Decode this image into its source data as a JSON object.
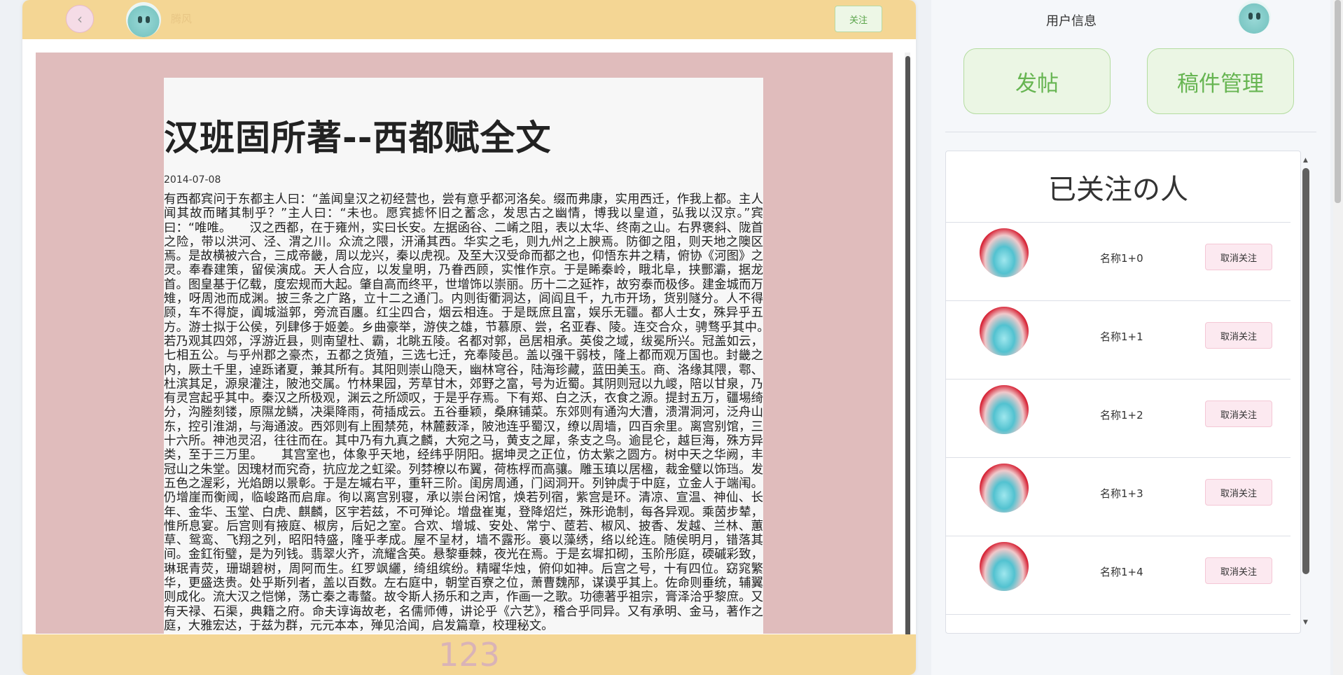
{
  "header": {
    "back_icon": "‹",
    "author_name": "腾风",
    "follow_label": "关注"
  },
  "article": {
    "title": "汉班固所著--西都赋全文",
    "date": "2014-07-08",
    "body": "有西都宾问于东都主人曰：“盖闻皇汉之初经营也，尝有意乎都河洛矣。缀而弗康，实用西迁，作我上都。主人闻其故而睹其制乎？”主人曰：“未也。愿宾摅怀旧之蓄念，发思古之幽情，博我以皇道，弘我以汉京。”宾曰：“唯唯。　　汉之西都，在于雍州，实曰长安。左据函谷、二崤之阻，表以太华、终南之山。右界褒斜、陇首之险，带以洪河、泾、渭之川。众流之隈，汧涌其西。华实之毛，则九州之上腴焉。防御之阻，则天地之隩区焉。是故横被六合，三成帝畿，周以龙兴，秦以虎视。及至大汉受命而都之也，仰悟东井之精，俯协《河图》之灵。奉春建策，留侯演成。天人合应，以发皇明，乃眷西顾，实惟作京。于是睎秦岭，睋北阜，挟酆灞，据龙首。图皇基于亿载，度宏规而大起。肇自高而终平，世增饰以崇丽。历十二之延祚，故穷泰而极侈。建金城而万雉，呀周池而成渊。披三条之广路，立十二之通门。内则街衢洞达，闾阎且千，九市开场，货别隧分。人不得顾，车不得旋，阗城溢郭，旁流百廛。红尘四合，烟云相连。于是既庶且富，娱乐无疆。都人士女，殊异乎五方。游士拟于公侯，列肆侈于姬姜。乡曲豪举，游侠之雄，节慕原、尝，名亚春、陵。连交合众，骋骛乎其中。　　若乃观其四郊，浮游近县，则南望杜、霸，北眺五陵。名都对郭，邑居相承。英俊之域，绂冕所兴。冠盖如云，七相五公。与乎州郡之豪杰，五都之货殖，三选七迁，充奉陵邑。盖以强干弱枝，隆上都而观万国也。封畿之内，厥土千里，逴跞诸夏，兼其所有。其阳则崇山隐天，幽林穹谷，陆海珍藏，蓝田美玉。商、洛缘其隈，鄠、杜滨其足，源泉灌注，陂池交属。竹林果园，芳草甘木，郊野之富，号为近蜀。其阴则冠以九嵕，陪以甘泉，乃有灵宫起乎其中。秦汉之所极观，渊云之所颂叹，于是乎存焉。下有郑、白之沃，衣食之源。提封五万，疆埸绮分，沟塍刻镂，原隰龙鳞，决渠降雨，荷插成云。五谷垂颖，桑麻铺菜。东郊则有通沟大漕，溃渭洞河，泛舟山东，控引淮湖，与海通波。西郊则有上囿禁苑，林麓薮泽，陂池连乎蜀汉，缭以周墙，四百余里。离宫别馆，三十六所。神池灵沼，往往而在。其中乃有九真之麟，大宛之马，黄支之犀，条支之鸟。逾昆仑，越巨海，殊方异类，至于三万里。　　其宫室也，体象乎天地，经纬乎阴阳。据坤灵之正位，仿太紫之圆方。树中天之华阙，丰冠山之朱堂。因瑰材而究奇，抗应龙之虹梁。列棼橑以布翼，荷栋桴而高骧。雕玉瑱以居楹，裁金璧以饰珰。发五色之渥彩，光焰朗以景彰。于是左墄右平，重轩三阶。闺房周通，门闼洞开。列钟虡于中庭，立金人于端闱。仍增崖而衡阈，临峻路而启扉。徇以离宫别寝，承以崇台闲馆，焕若列宿，紫宫是环。清凉、宣温、神仙、长年、金华、玉堂、白虎、麒麟，区宇若兹，不可殚论。增盘崔嵬，登降炤烂，殊形诡制，每各异观。乘茵步辇，惟所息宴。后宫则有掖庭、椒房，后妃之室。合欢、增城、安处、常宁、茝若、椒风、披香、发越、兰林、蕙草、鸳鸾、飞翔之列，昭阳特盛，隆乎孝成。屋不呈材，墙不露形。裛以藻绣，络以纶连。随侯明月，错落其间。金釭衔璧，是为列钱。翡翠火齐，流耀含英。悬黎垂棘，夜光在焉。于是玄墀扣砌，玉阶彤庭，碝磩彩致，琳珉青荧，珊瑚碧树，周阿而生。红罗飒纚，绮组缤纷。精曜华烛，俯仰如神。后宫之号，十有四位。窈窕繁华，更盛迭贵。处乎斯列者，盖以百数。左右庭中，朝堂百寮之位，萧曹魏邴，谋谟乎其上。佐命则垂统，辅翼则成化。流大汉之恺悌，荡亡秦之毒螫。故令斯人扬乐和之声，作画一之歌。功德著乎祖宗，膏泽洽乎黎庶。又有天禄、石渠，典籍之府。命夫谆诲故老，名儒师傅，讲论乎《六艺》，稽合乎同异。又有承明、金马，著作之庭，大雅宏达，于兹为群，元元本本，殚见洽闻，启发篇章，校理秘文。"
  },
  "footer": {
    "page_number": "123"
  },
  "sidebar": {
    "user_info_title": "用户信息",
    "post_label": "发帖",
    "drafts_label": "稿件管理",
    "followed_title": "已关注の人",
    "unfollow_label": "取消关注",
    "followed": [
      {
        "name": "名称1+0"
      },
      {
        "name": "名称1+1"
      },
      {
        "name": "名称1+2"
      },
      {
        "name": "名称1+3"
      },
      {
        "name": "名称1+4"
      }
    ]
  },
  "colors": {
    "bar_yellow": "#f4d694",
    "content_pink": "#e0bcbc",
    "green_accent": "#67b552",
    "pink_button": "#fce9f0"
  }
}
